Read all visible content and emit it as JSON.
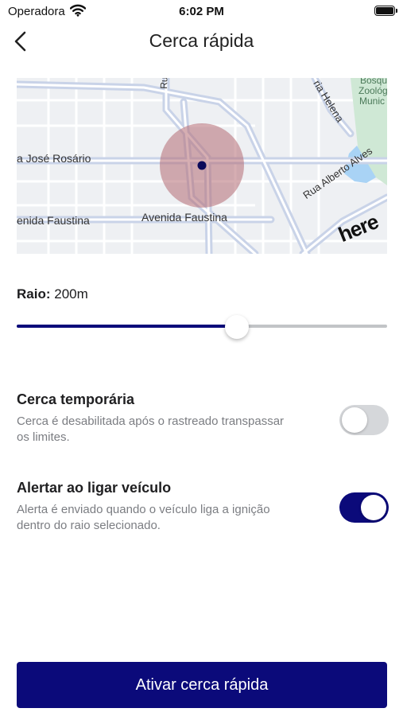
{
  "status_bar": {
    "carrier": "Operadora",
    "time": "6:02 PM",
    "icons": [
      "wifi-icon",
      "battery-icon"
    ]
  },
  "header": {
    "back_icon": "chevron-left-icon",
    "title": "Cerca rápida"
  },
  "map": {
    "streets": {
      "jose_rosario": "a José Rosário",
      "faustina_left": "enida Faustina",
      "faustina_main": "Avenida Faustina",
      "alberto_alves": "Rua Alberto Alves",
      "helena": "ria Helena",
      "zoo_line1": "Bosqu",
      "zoo_line2": "Zoológ",
      "zoo_line3": "Munic",
      "top_road": "Rua"
    },
    "provider_logo": "here",
    "colors": {
      "fence_circle": "#b56b72",
      "center_dot": "#0b0a5a",
      "park": "#cfe8d5",
      "water": "#a9d3f5"
    }
  },
  "radius": {
    "label": "Raio:",
    "value": "200m",
    "slider_fraction": 0.595
  },
  "options": [
    {
      "title": "Cerca temporária",
      "description": "Cerca é desabilitada após o rastreado transpassar os limites.",
      "enabled": false
    },
    {
      "title": "Alertar ao ligar veículo",
      "description": "Alerta é enviado quando o veículo liga a ignição dentro do raio selecionado.",
      "enabled": true
    }
  ],
  "actions": {
    "activate_label": "Ativar cerca rápida"
  },
  "theme": {
    "accent": "#0b0a7a",
    "toggle_off": "#d5d7da",
    "muted_text": "#7b7d82"
  }
}
